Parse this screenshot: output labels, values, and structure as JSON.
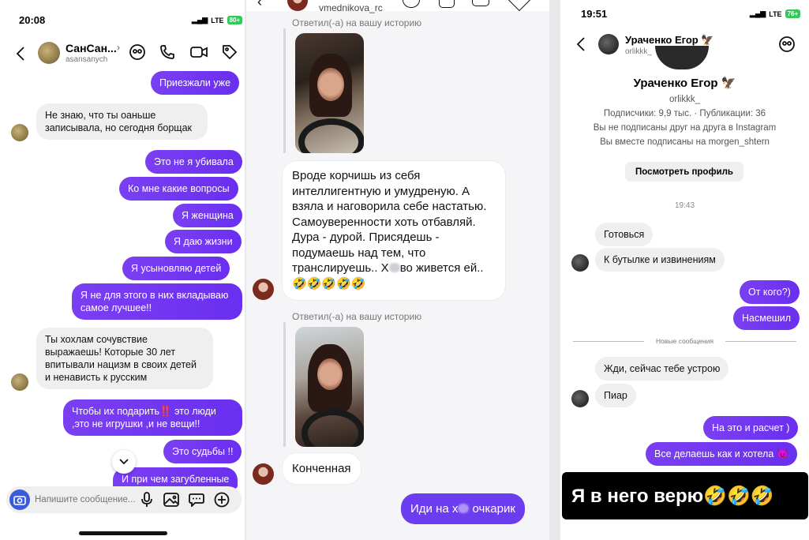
{
  "left": {
    "time": "20:08",
    "network": "LTE",
    "battery": "80+",
    "contact_name": "СанСан...",
    "contact_handle": "asansanych",
    "messages": [
      {
        "side": "out",
        "text": "Приезжали уже"
      },
      {
        "side": "in",
        "text": "Не знаю, что ты оаньше записывала, но сегодня борщак"
      },
      {
        "side": "out",
        "text": "Это не я убивала"
      },
      {
        "side": "out",
        "text": "Ко мне какие вопросы"
      },
      {
        "side": "out",
        "text": "Я женщина"
      },
      {
        "side": "out",
        "text": "Я даю жизни"
      },
      {
        "side": "out",
        "text": "Я усыновляю детей"
      },
      {
        "side": "out",
        "text": "Я не для этого в них вкладываю самое лучшее!!"
      },
      {
        "side": "in",
        "text": "Ты хохлам сочувствие выражаешь! Которые 30 лет впитывали нацизм в своих детей и ненависть к русским"
      },
      {
        "side": "out",
        "text_a": "Чтобы их подарить",
        "emoji": "‼️",
        "text_b": "это люди ,это не игрушки ,и не вещи!!"
      },
      {
        "side": "out",
        "text": "Это судьбы !!"
      },
      {
        "side": "out",
        "text": "И при чем загубленные"
      }
    ],
    "composer_placeholder": "Напишите сообщение..."
  },
  "middle": {
    "header_handle": "vmednikova_rc",
    "reply_label_1": "Ответил(-а) на вашу историю",
    "message_1_a": "Вроде корчишь из себя интеллигентную и умудреную. А взяла и наговорила себе настатью. Самоуверенности хоть отбавляй. Дура - дурой. Присядешь - подумаешь над тем, что транслируешь.. Х",
    "message_1_b": "во живется ей.. 🤣🤣🤣🤣🤣",
    "reply_label_2": "Ответил(-а) на вашу историю",
    "message_2": "Конченная",
    "message_3_a": "Иди на х",
    "message_3_b": "очкарик"
  },
  "right": {
    "time": "19:51",
    "network": "LTE",
    "battery": "76+",
    "header_name": "Ураченко Егор 🦅",
    "header_handle": "orlikkk_",
    "profile_name": "Ураченко Егор 🦅",
    "profile_handle": "orlikkk_",
    "stats": "Подписчики: 9,9 тыс. · Публикации: 36",
    "not_following": "Вы не подписаны друг на друга в Instagram",
    "mutual": "Вы вместе подписаны на morgen_shtern",
    "view_profile": "Посмотреть профиль",
    "timestamp": "19:43",
    "messages_a": [
      {
        "side": "in",
        "text": "Готовься"
      },
      {
        "side": "in",
        "text": "К бутылке и извинениям"
      },
      {
        "side": "out",
        "text": "От кого?)"
      },
      {
        "side": "out",
        "text": "Насмешил"
      }
    ],
    "new_messages": "Новые сообщения",
    "messages_b": [
      {
        "side": "in",
        "text": "Жди, сейчас тебе устрою"
      },
      {
        "side": "in",
        "text": "Пиар"
      },
      {
        "side": "out",
        "text": "На это и расчет )"
      },
      {
        "side": "out",
        "text": "Все делаешь как и хотела 😈"
      }
    ],
    "caption": "Я в него верю🤣🤣🤣"
  },
  "colors": {
    "outgoing": "#7b3ff2",
    "incoming": "#efefef",
    "accent": "#3b5bdb"
  }
}
